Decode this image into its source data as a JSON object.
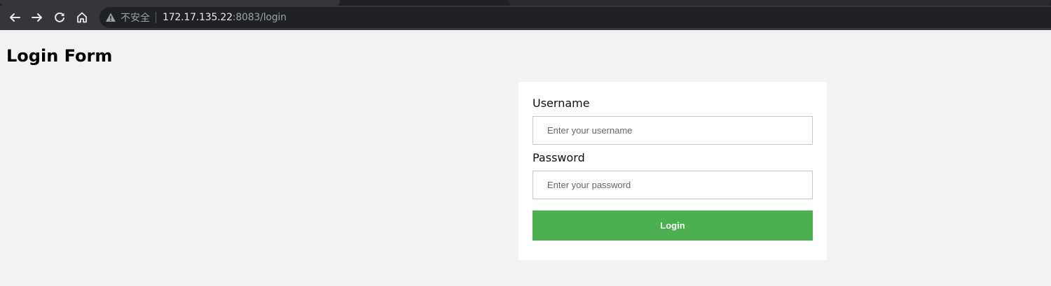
{
  "browser": {
    "security_label": "不安全",
    "url_host": "172.17.135.22",
    "url_rest": ":8083/login",
    "icons": [
      "back-arrow-icon",
      "forward-arrow-icon",
      "reload-icon",
      "home-icon",
      "warning-icon"
    ]
  },
  "page": {
    "title": "Login Form"
  },
  "form": {
    "username_label": "Username",
    "username_placeholder": "Enter your username",
    "username_value": "",
    "password_label": "Password",
    "password_placeholder": "Enter your password",
    "password_value": "",
    "submit_label": "Login"
  },
  "colors": {
    "page_background": "#f2f2f2",
    "card_background": "#ffffff",
    "button_background": "#4caf50",
    "button_text": "#ffffff"
  }
}
